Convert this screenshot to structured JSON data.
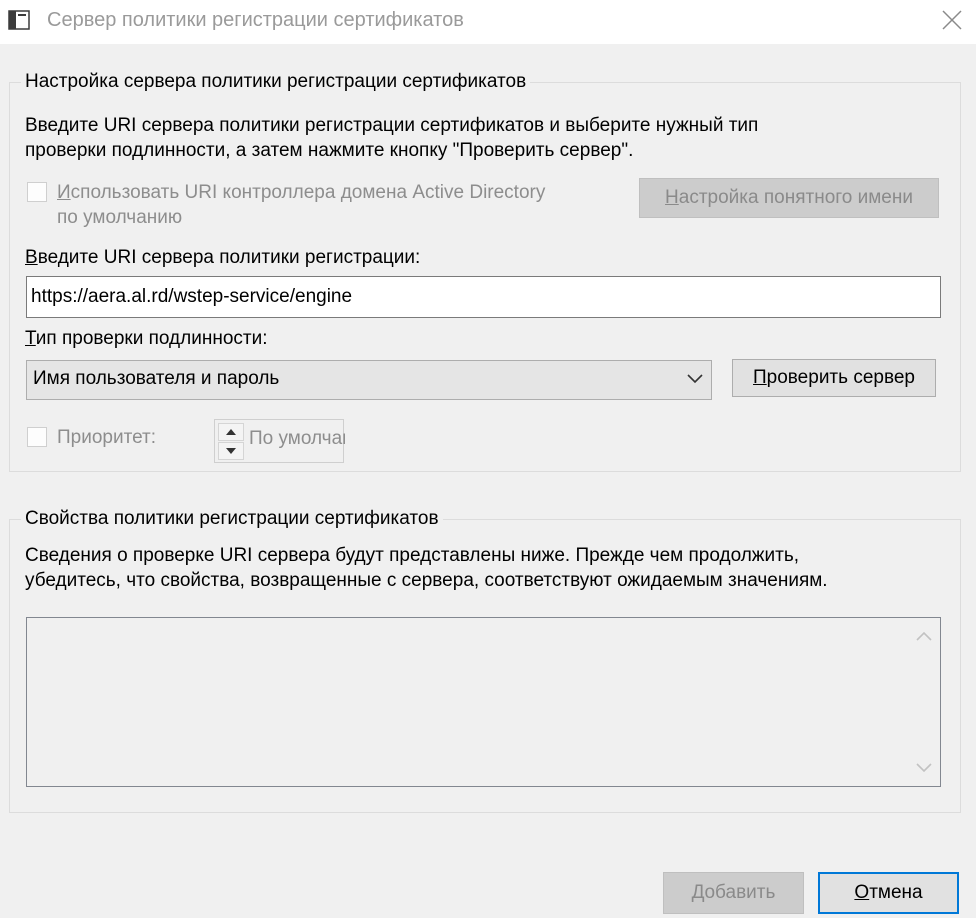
{
  "window": {
    "title": "Сервер политики регистрации сертификатов"
  },
  "config_group": {
    "legend": "Настройка сервера политики регистрации сертификатов",
    "instructions_line1": "Введите URI сервера политики регистрации сертификатов и выберите нужный тип",
    "instructions_line2": "проверки подлинности, а затем нажмите кнопку \"Проверить сервер\".",
    "use_ad_checkbox": {
      "label_line1_hotkey": "И",
      "label_line1_rest": "спользовать URI контроллера домена Active Directory",
      "label_line2": "по умолчанию",
      "checked": false
    },
    "friendly_name_button": {
      "hotkey": "Н",
      "rest": "астройка понятного имени"
    },
    "uri_label": {
      "hotkey": "В",
      "rest": "ведите URI сервера политики регистрации:"
    },
    "uri_value": "https://aera.al.rd/wstep-service/engine",
    "auth_label": {
      "hotkey": "Т",
      "rest": "ип проверки подлинности:"
    },
    "auth_selected": "Имя пользователя и пароль",
    "validate_button": {
      "hotkey": "П",
      "rest": "роверить сервер"
    },
    "priority_checkbox": {
      "label": "Приоритет:",
      "checked": false
    },
    "priority_value": "По умолчанию"
  },
  "properties_group": {
    "legend": "Свойства политики регистрации сертификатов",
    "info_line1": "Сведения о проверке URI сервера будут представлены ниже. Прежде чем продолжить,",
    "info_line2": "убедитесь, что свойства, возвращенные с сервера, соответствуют ожидаемым значениям."
  },
  "footer": {
    "add_button": {
      "hotkey": "Д",
      "rest": "обавить"
    },
    "cancel_button": {
      "hotkey": "О",
      "rest": "тмена"
    }
  }
}
